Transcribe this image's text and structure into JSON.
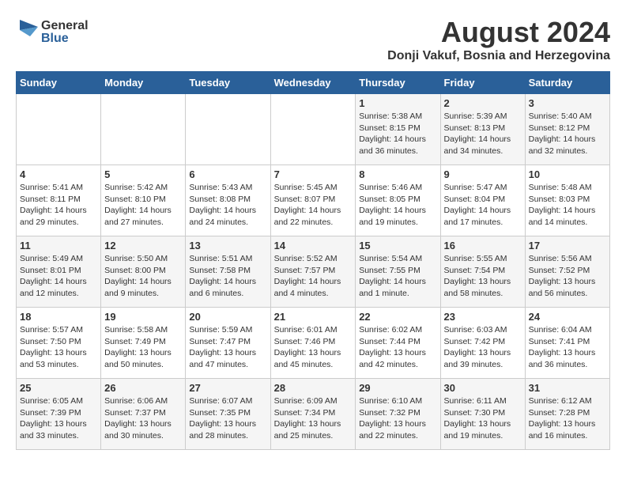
{
  "header": {
    "logo_general": "General",
    "logo_blue": "Blue",
    "title": "August 2024",
    "subtitle": "Donji Vakuf, Bosnia and Herzegovina"
  },
  "weekdays": [
    "Sunday",
    "Monday",
    "Tuesday",
    "Wednesday",
    "Thursday",
    "Friday",
    "Saturday"
  ],
  "weeks": [
    [
      {
        "day": "",
        "info": ""
      },
      {
        "day": "",
        "info": ""
      },
      {
        "day": "",
        "info": ""
      },
      {
        "day": "",
        "info": ""
      },
      {
        "day": "1",
        "info": "Sunrise: 5:38 AM\nSunset: 8:15 PM\nDaylight: 14 hours\nand 36 minutes."
      },
      {
        "day": "2",
        "info": "Sunrise: 5:39 AM\nSunset: 8:13 PM\nDaylight: 14 hours\nand 34 minutes."
      },
      {
        "day": "3",
        "info": "Sunrise: 5:40 AM\nSunset: 8:12 PM\nDaylight: 14 hours\nand 32 minutes."
      }
    ],
    [
      {
        "day": "4",
        "info": "Sunrise: 5:41 AM\nSunset: 8:11 PM\nDaylight: 14 hours\nand 29 minutes."
      },
      {
        "day": "5",
        "info": "Sunrise: 5:42 AM\nSunset: 8:10 PM\nDaylight: 14 hours\nand 27 minutes."
      },
      {
        "day": "6",
        "info": "Sunrise: 5:43 AM\nSunset: 8:08 PM\nDaylight: 14 hours\nand 24 minutes."
      },
      {
        "day": "7",
        "info": "Sunrise: 5:45 AM\nSunset: 8:07 PM\nDaylight: 14 hours\nand 22 minutes."
      },
      {
        "day": "8",
        "info": "Sunrise: 5:46 AM\nSunset: 8:05 PM\nDaylight: 14 hours\nand 19 minutes."
      },
      {
        "day": "9",
        "info": "Sunrise: 5:47 AM\nSunset: 8:04 PM\nDaylight: 14 hours\nand 17 minutes."
      },
      {
        "day": "10",
        "info": "Sunrise: 5:48 AM\nSunset: 8:03 PM\nDaylight: 14 hours\nand 14 minutes."
      }
    ],
    [
      {
        "day": "11",
        "info": "Sunrise: 5:49 AM\nSunset: 8:01 PM\nDaylight: 14 hours\nand 12 minutes."
      },
      {
        "day": "12",
        "info": "Sunrise: 5:50 AM\nSunset: 8:00 PM\nDaylight: 14 hours\nand 9 minutes."
      },
      {
        "day": "13",
        "info": "Sunrise: 5:51 AM\nSunset: 7:58 PM\nDaylight: 14 hours\nand 6 minutes."
      },
      {
        "day": "14",
        "info": "Sunrise: 5:52 AM\nSunset: 7:57 PM\nDaylight: 14 hours\nand 4 minutes."
      },
      {
        "day": "15",
        "info": "Sunrise: 5:54 AM\nSunset: 7:55 PM\nDaylight: 14 hours\nand 1 minute."
      },
      {
        "day": "16",
        "info": "Sunrise: 5:55 AM\nSunset: 7:54 PM\nDaylight: 13 hours\nand 58 minutes."
      },
      {
        "day": "17",
        "info": "Sunrise: 5:56 AM\nSunset: 7:52 PM\nDaylight: 13 hours\nand 56 minutes."
      }
    ],
    [
      {
        "day": "18",
        "info": "Sunrise: 5:57 AM\nSunset: 7:50 PM\nDaylight: 13 hours\nand 53 minutes."
      },
      {
        "day": "19",
        "info": "Sunrise: 5:58 AM\nSunset: 7:49 PM\nDaylight: 13 hours\nand 50 minutes."
      },
      {
        "day": "20",
        "info": "Sunrise: 5:59 AM\nSunset: 7:47 PM\nDaylight: 13 hours\nand 47 minutes."
      },
      {
        "day": "21",
        "info": "Sunrise: 6:01 AM\nSunset: 7:46 PM\nDaylight: 13 hours\nand 45 minutes."
      },
      {
        "day": "22",
        "info": "Sunrise: 6:02 AM\nSunset: 7:44 PM\nDaylight: 13 hours\nand 42 minutes."
      },
      {
        "day": "23",
        "info": "Sunrise: 6:03 AM\nSunset: 7:42 PM\nDaylight: 13 hours\nand 39 minutes."
      },
      {
        "day": "24",
        "info": "Sunrise: 6:04 AM\nSunset: 7:41 PM\nDaylight: 13 hours\nand 36 minutes."
      }
    ],
    [
      {
        "day": "25",
        "info": "Sunrise: 6:05 AM\nSunset: 7:39 PM\nDaylight: 13 hours\nand 33 minutes."
      },
      {
        "day": "26",
        "info": "Sunrise: 6:06 AM\nSunset: 7:37 PM\nDaylight: 13 hours\nand 30 minutes."
      },
      {
        "day": "27",
        "info": "Sunrise: 6:07 AM\nSunset: 7:35 PM\nDaylight: 13 hours\nand 28 minutes."
      },
      {
        "day": "28",
        "info": "Sunrise: 6:09 AM\nSunset: 7:34 PM\nDaylight: 13 hours\nand 25 minutes."
      },
      {
        "day": "29",
        "info": "Sunrise: 6:10 AM\nSunset: 7:32 PM\nDaylight: 13 hours\nand 22 minutes."
      },
      {
        "day": "30",
        "info": "Sunrise: 6:11 AM\nSunset: 7:30 PM\nDaylight: 13 hours\nand 19 minutes."
      },
      {
        "day": "31",
        "info": "Sunrise: 6:12 AM\nSunset: 7:28 PM\nDaylight: 13 hours\nand 16 minutes."
      }
    ]
  ]
}
